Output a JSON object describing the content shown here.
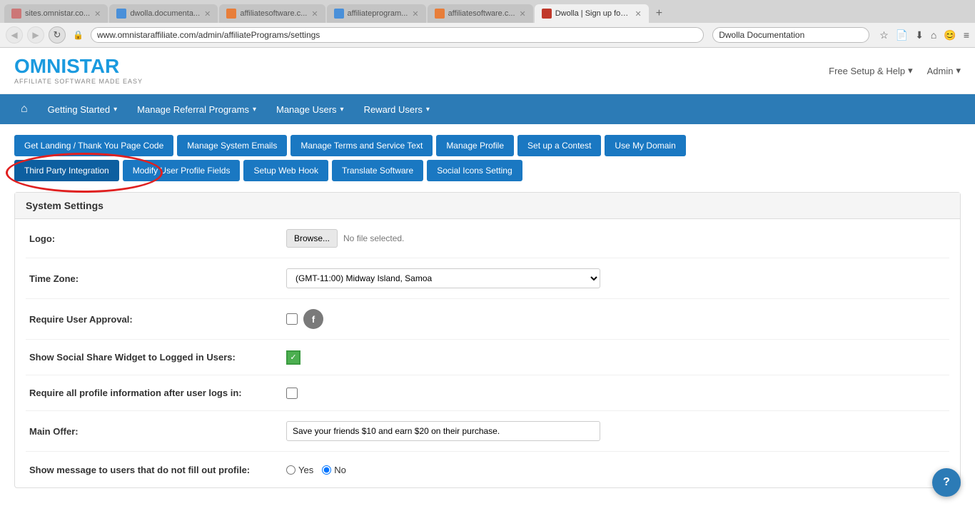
{
  "browser": {
    "tabs": [
      {
        "id": "tab1",
        "label": "sites.omnistar.co...",
        "favicon": "red",
        "active": false
      },
      {
        "id": "tab2",
        "label": "dwolla.documenta...",
        "favicon": "blue",
        "active": false
      },
      {
        "id": "tab3",
        "label": "affiliatesoftware.c...",
        "favicon": "orange",
        "active": false
      },
      {
        "id": "tab4",
        "label": "affiliateprogram...",
        "favicon": "blue",
        "active": false
      },
      {
        "id": "tab5",
        "label": "affiliatesoftware.c...",
        "favicon": "orange",
        "active": false
      },
      {
        "id": "tab6",
        "label": "Dwolla | Sign up for a fre...",
        "favicon": "dwolla",
        "active": true
      }
    ],
    "address": "www.omnistaraffiliate.com/admin/affiliatePrograms/settings",
    "search": "Dwolla Documentation"
  },
  "app": {
    "logo_part1": "OMNI",
    "logo_part2": "STAR",
    "logo_subtitle": "AFFILIATE SOFTWARE MADE EASY",
    "header_nav": [
      {
        "label": "Free Setup & Help",
        "has_arrow": true
      },
      {
        "label": "Admin",
        "has_arrow": true
      }
    ]
  },
  "main_nav": {
    "items": [
      {
        "label": "🏠",
        "is_home": true
      },
      {
        "label": "Getting Started",
        "has_arrow": true
      },
      {
        "label": "Manage Referral Programs",
        "has_arrow": true
      },
      {
        "label": "Manage Users",
        "has_arrow": true
      },
      {
        "label": "Reward Users",
        "has_arrow": true
      }
    ]
  },
  "toolbar": {
    "buttons": [
      {
        "id": "landing",
        "label": "Get Landing / Thank You Page Code"
      },
      {
        "id": "emails",
        "label": "Manage System Emails"
      },
      {
        "id": "terms",
        "label": "Manage Terms and Service Text"
      },
      {
        "id": "profile",
        "label": "Manage Profile"
      },
      {
        "id": "contest",
        "label": "Set up a Contest"
      },
      {
        "id": "domain",
        "label": "Use My Domain"
      },
      {
        "id": "third-party",
        "label": "Third Party Integration",
        "active": true
      },
      {
        "id": "user-profile",
        "label": "Modify User Profile Fields"
      },
      {
        "id": "webhook",
        "label": "Setup Web Hook"
      },
      {
        "id": "translate",
        "label": "Translate Software"
      },
      {
        "id": "social",
        "label": "Social Icons Setting"
      }
    ]
  },
  "settings": {
    "title": "System Settings",
    "fields": [
      {
        "id": "logo",
        "label": "Logo:",
        "type": "file",
        "button_label": "Browse...",
        "no_file_text": "No file selected."
      },
      {
        "id": "timezone",
        "label": "Time Zone:",
        "type": "select",
        "value": "(GMT-11:00) Midway Island, Samoa"
      },
      {
        "id": "user-approval",
        "label": "Require User Approval:",
        "type": "checkbox-with-icon",
        "checked": false
      },
      {
        "id": "social-widget",
        "label": "Show Social Share Widget to Logged in Users:",
        "type": "checkbox-checked"
      },
      {
        "id": "profile-info",
        "label": "Require all profile information after user logs in:",
        "type": "checkbox",
        "checked": false
      },
      {
        "id": "main-offer",
        "label": "Main Offer:",
        "type": "text",
        "value": "Save your friends $10 and earn $20 on their purchase."
      },
      {
        "id": "show-message",
        "label": "Show message to users that do not fill out profile:",
        "type": "radio",
        "options": [
          {
            "value": "yes",
            "label": "Yes",
            "checked": false
          },
          {
            "value": "no",
            "label": "No",
            "checked": true
          }
        ]
      }
    ]
  },
  "help_button_label": "?"
}
